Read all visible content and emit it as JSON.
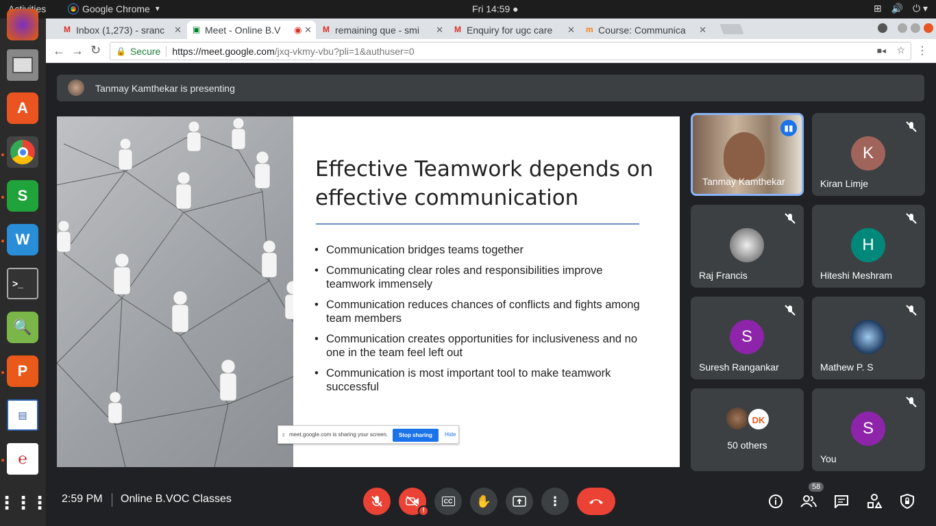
{
  "system": {
    "activities": "Activities",
    "app_name": "Google Chrome",
    "clock": "Fri 14:59"
  },
  "browser": {
    "tabs": [
      {
        "label": "Inbox (1,273) - sranc",
        "icon": "gmail-icon"
      },
      {
        "label": "Meet - Online B.V",
        "icon": "meet-icon"
      },
      {
        "label": "remaining que - smi",
        "icon": "gmail-icon"
      },
      {
        "label": "Enquiry for ugc care",
        "icon": "gmail-icon"
      },
      {
        "label": "Course: Communica",
        "icon": "moodle-icon"
      }
    ],
    "secure_label": "Secure",
    "url_host": "https://meet.google.com",
    "url_path": "/jxq-vkmy-vbu?pli=1&authuser=0"
  },
  "meet": {
    "presenting_text": "Tanmay Kamthekar is presenting",
    "slide": {
      "title": "Effective Teamwork depends on effective communication",
      "bullets": [
        "Communication bridges teams together",
        "Communicating clear roles and responsibilities improve teamwork immensely",
        "Communication reduces chances of conflicts and fights among team members",
        "Communication creates opportunities for inclusiveness and no one in the team feel left out",
        "Communication is most important tool to make teamwork successful"
      ]
    },
    "share_banner": {
      "text": "meet.google.com is sharing your screen.",
      "stop": "Stop sharing",
      "hide": "Hide"
    },
    "participants": [
      {
        "name": "Tanmay Kamthekar",
        "initial": "",
        "color": "#6b5a4a"
      },
      {
        "name": "Kiran Limje",
        "initial": "K",
        "color": "#a1645a"
      },
      {
        "name": "Raj Francis",
        "initial": "",
        "color": "#888"
      },
      {
        "name": "Hiteshi Meshram",
        "initial": "H",
        "color": "#00897b"
      },
      {
        "name": "Suresh Rangankar",
        "initial": "S",
        "color": "#8e24aa"
      },
      {
        "name": "Mathew P. S",
        "initial": "",
        "color": "#1e3a5f"
      },
      {
        "name": "50 others",
        "initial": "",
        "color": "#555"
      },
      {
        "name": "You",
        "initial": "S",
        "color": "#8e24aa"
      }
    ],
    "bottom": {
      "time": "2:59 PM",
      "meeting_name": "Online B.VOC Classes",
      "people_count": "58"
    }
  }
}
